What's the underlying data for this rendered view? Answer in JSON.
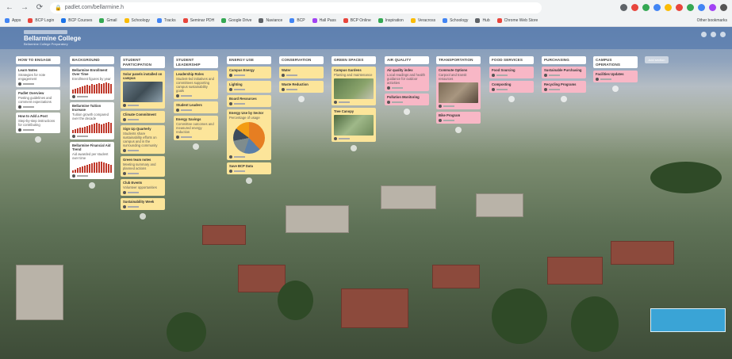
{
  "browser": {
    "url": "padlet.com/bellarmine.h",
    "bookmarks": [
      "Apps",
      "BCP Login",
      "BCP Courses",
      "Gmail",
      "Schoology",
      "Tracks",
      "Seminar PDH",
      "Google Drive",
      "Naviance",
      "BCP",
      "Hall Pass",
      "BCP Online",
      "Inspiration",
      "Veracross",
      "Schoology",
      "Hub",
      "Chrome Web Store"
    ],
    "other_bookmarks": "Other bookmarks",
    "colors": [
      "#5f6368",
      "#e8453c",
      "#34a853",
      "#4285f4",
      "#fbbc05",
      "#e8453c",
      "#34a853",
      "#4285f4",
      "#a142f4",
      "#555555"
    ]
  },
  "board": {
    "author": "Bellarmine",
    "title": "Bellarmine College",
    "subtitle": "Bellarmine College Preparatory"
  },
  "columns": [
    {
      "id": "c1",
      "header": "HOW TO ENGAGE",
      "cards": [
        {
          "color": "white",
          "title": "Learn Notes",
          "body": "Strategies for note engagement",
          "kind": "text"
        },
        {
          "color": "white",
          "title": "Padlet Overview",
          "body": "Posting guidelines and comment expectations",
          "kind": "text"
        },
        {
          "color": "white",
          "title": "How to Add a Post",
          "body": "Step-by-step instructions for contributing",
          "kind": "text"
        }
      ]
    },
    {
      "id": "c2",
      "header": "BACKGROUND",
      "cards": [
        {
          "color": "white",
          "title": "Bellarmine Enrollment Over Time",
          "body": "Enrollment figures by year",
          "kind": "bars"
        },
        {
          "color": "white",
          "title": "Bellarmine Tuition Increase",
          "body": "Tuition growth compared over the decade",
          "kind": "bars"
        },
        {
          "color": "white",
          "title": "Bellarmine Financial Aid Trend",
          "body": "Aid awarded per student over time",
          "kind": "bars"
        }
      ]
    },
    {
      "id": "c3",
      "header": "STUDENT PARTICIPATION",
      "cards": [
        {
          "color": "yellow",
          "title": "Solar panels installed on campus",
          "body": "",
          "kind": "photo"
        },
        {
          "color": "yellow",
          "title": "Climate Commitment",
          "body": "",
          "kind": "text"
        },
        {
          "color": "yellow",
          "title": "Sign Up Quarterly",
          "body": "Students share sustainability efforts on campus and in the surrounding community",
          "kind": "text"
        },
        {
          "color": "yellow",
          "title": "Green team notes",
          "body": "Meeting summary and planned actions",
          "kind": "text"
        },
        {
          "color": "yellow",
          "title": "Club Events",
          "body": "Volunteer opportunities",
          "kind": "text"
        },
        {
          "color": "yellow",
          "title": "Sustainability Week",
          "body": "",
          "kind": "text"
        }
      ]
    },
    {
      "id": "c4",
      "header": "STUDENT LEADERSHIP",
      "cards": [
        {
          "color": "yellow",
          "title": "Leadership Roles",
          "body": "Student-led initiatives and committees supporting campus sustainability goals",
          "kind": "text"
        },
        {
          "color": "yellow",
          "title": "Student Leaders",
          "body": "",
          "kind": "text"
        },
        {
          "color": "yellow",
          "title": "Energy Savings",
          "body": "Committee outcomes and measured energy reduction",
          "kind": "text"
        }
      ]
    },
    {
      "id": "c5",
      "header": "ENERGY USE",
      "cards": [
        {
          "color": "yellow",
          "title": "Campus Energy",
          "body": "",
          "kind": "text"
        },
        {
          "color": "yellow",
          "title": "Lighting",
          "body": "",
          "kind": "text"
        },
        {
          "color": "yellow",
          "title": "Board Resources",
          "body": "",
          "kind": "text"
        },
        {
          "color": "yellow",
          "title": "Energy Use by Sector",
          "body": "Percentage of usage",
          "kind": "pie"
        },
        {
          "color": "yellow",
          "title": "Save BCP Data",
          "body": "",
          "kind": "text"
        }
      ]
    },
    {
      "id": "c6",
      "header": "CONSERVATION",
      "cards": [
        {
          "color": "yellow",
          "title": "Water",
          "body": "",
          "kind": "text"
        },
        {
          "color": "yellow",
          "title": "Waste Reduction",
          "body": "",
          "kind": "text"
        }
      ]
    },
    {
      "id": "c7",
      "header": "GREEN SPACES",
      "cards": [
        {
          "color": "yellow",
          "title": "Campus Gardens",
          "body": "Planting and maintenance",
          "kind": "photo"
        },
        {
          "color": "yellow",
          "title": "Tree Canopy",
          "body": "",
          "kind": "photo"
        }
      ]
    },
    {
      "id": "c8",
      "header": "AIR QUALITY",
      "cards": [
        {
          "color": "pink",
          "title": "Air quality index",
          "body": "Local readings and health guidance for outdoor activities",
          "kind": "text"
        },
        {
          "color": "pink",
          "title": "Pollution Monitoring",
          "body": "",
          "kind": "text"
        }
      ]
    },
    {
      "id": "c9",
      "header": "TRANSPORTATION",
      "cards": [
        {
          "color": "pink",
          "title": "Commute Options",
          "body": "Carpool and transit resources",
          "kind": "photo"
        },
        {
          "color": "pink",
          "title": "Bike Program",
          "body": "",
          "kind": "text"
        }
      ]
    },
    {
      "id": "c10",
      "header": "FOOD SERVICES",
      "cards": [
        {
          "color": "pink",
          "title": "Food Sourcing",
          "body": "",
          "kind": "text"
        },
        {
          "color": "pink",
          "title": "Composting",
          "body": "",
          "kind": "text"
        }
      ]
    },
    {
      "id": "c11",
      "header": "PURCHASING",
      "cards": [
        {
          "color": "pink",
          "title": "Sustainable Purchasing",
          "body": "",
          "kind": "text"
        },
        {
          "color": "pink",
          "title": "Recycling Programs",
          "body": "",
          "kind": "text"
        }
      ]
    },
    {
      "id": "c12",
      "header": "CAMPUS OPERATIONS",
      "cards": [
        {
          "color": "pink",
          "title": "Facilities Updates",
          "body": "",
          "kind": "text"
        }
      ]
    }
  ],
  "add_column_label": "Add section"
}
